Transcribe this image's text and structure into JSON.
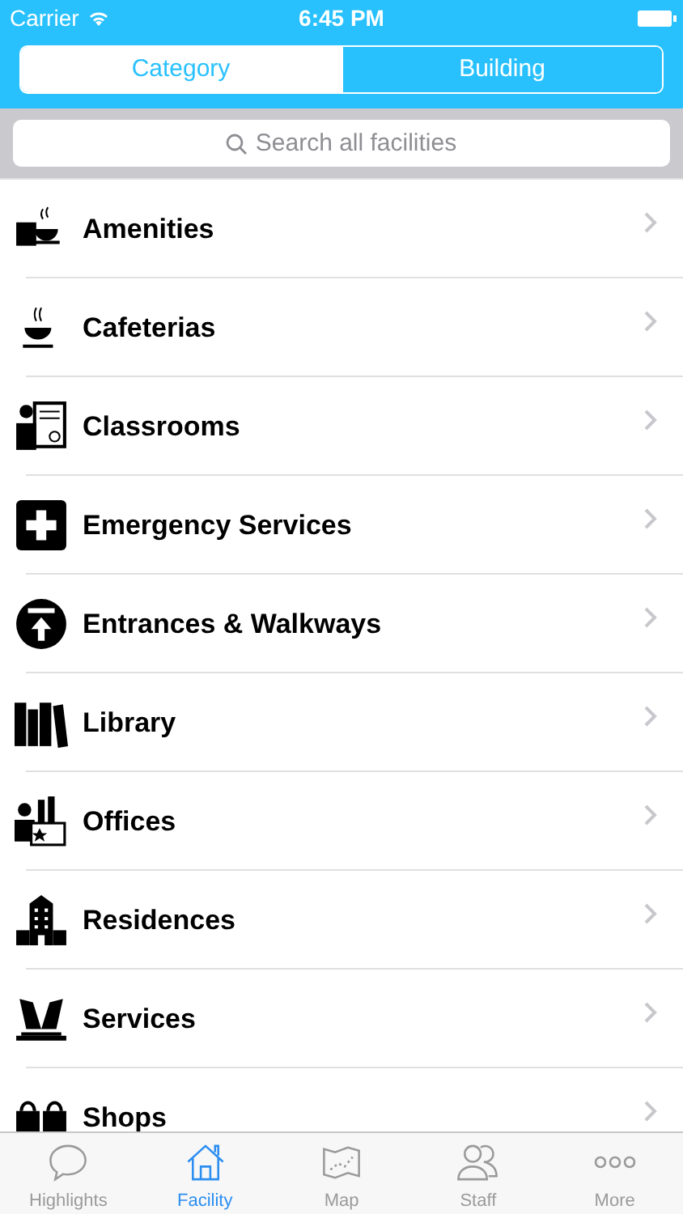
{
  "status_bar": {
    "carrier": "Carrier",
    "time": "6:45 PM"
  },
  "segments": [
    {
      "label": "Category",
      "selected": true
    },
    {
      "label": "Building",
      "selected": false
    }
  ],
  "search": {
    "placeholder": "Search all facilities"
  },
  "rows": [
    {
      "label": "Amenities"
    },
    {
      "label": "Cafeterias"
    },
    {
      "label": "Classrooms"
    },
    {
      "label": "Emergency Services"
    },
    {
      "label": "Entrances & Walkways"
    },
    {
      "label": "Library"
    },
    {
      "label": "Offices"
    },
    {
      "label": "Residences"
    },
    {
      "label": "Services"
    },
    {
      "label": "Shops"
    }
  ],
  "tab_bar": [
    {
      "label": "Highlights",
      "selected": false
    },
    {
      "label": "Facility",
      "selected": true
    },
    {
      "label": "Map",
      "selected": false
    },
    {
      "label": "Staff",
      "selected": false
    },
    {
      "label": "More",
      "selected": false
    }
  ]
}
